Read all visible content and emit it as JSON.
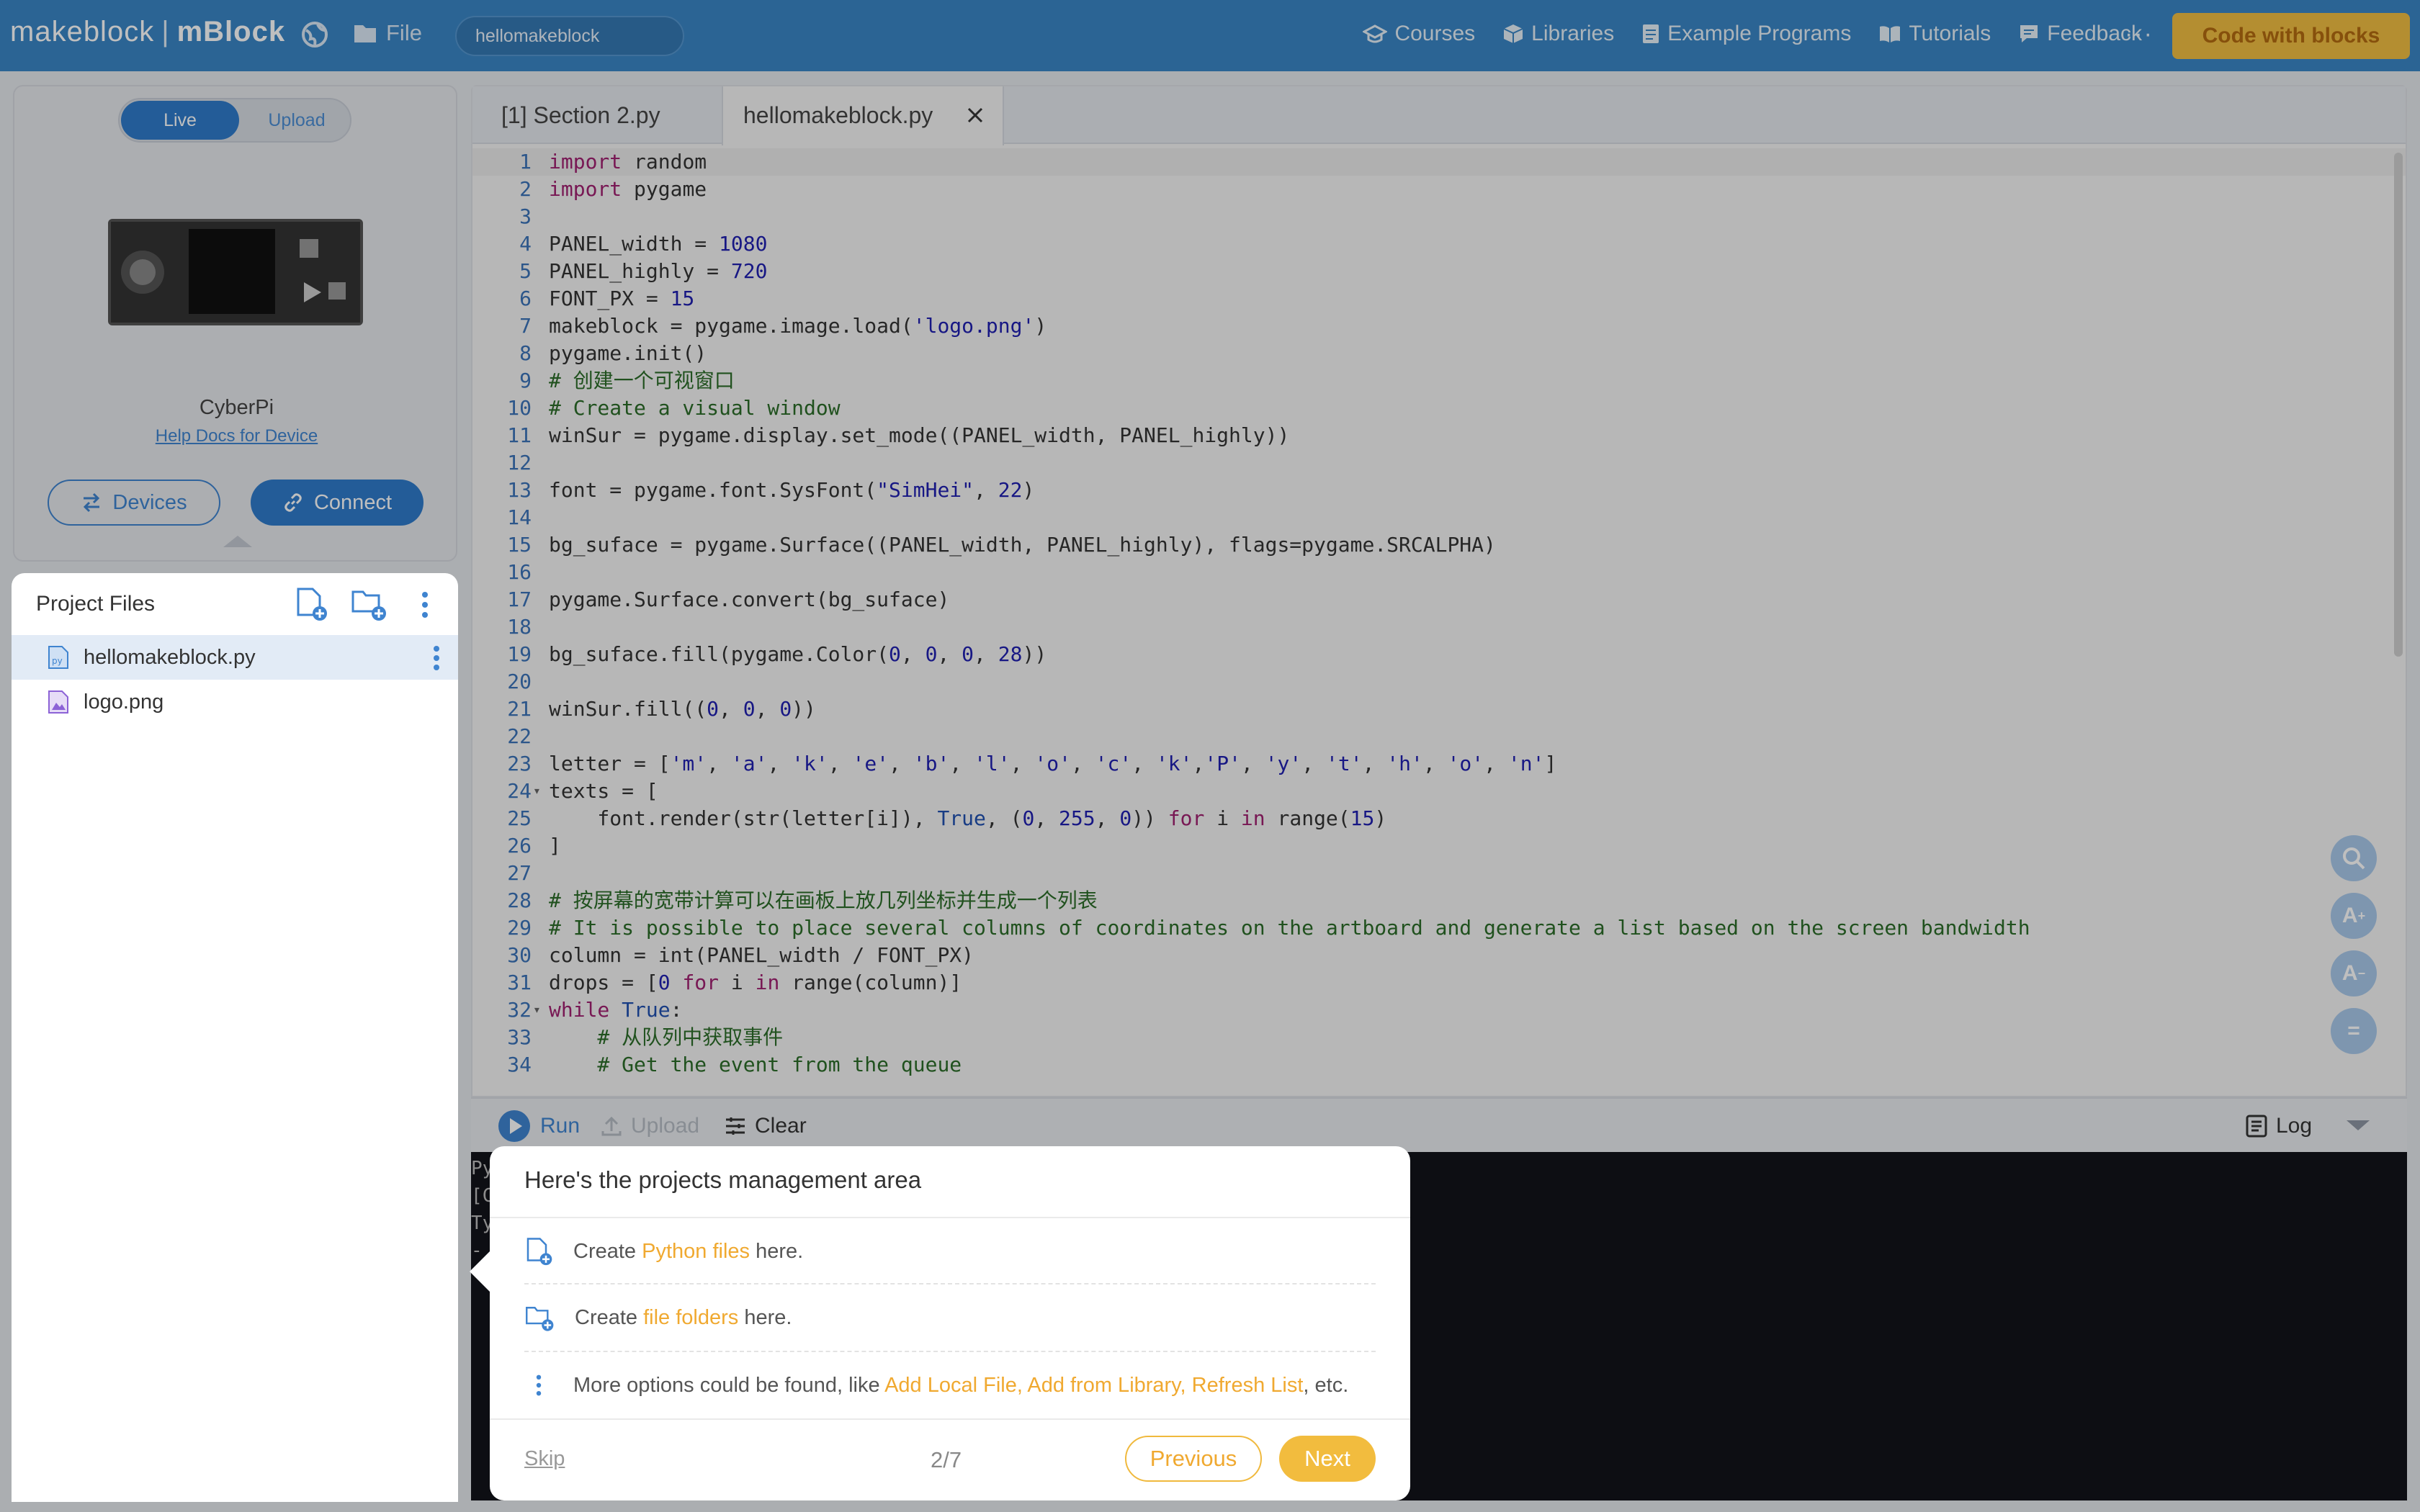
{
  "topbar": {
    "brand_left": "makeblock",
    "brand_sep": "|",
    "brand_right": "mBlock",
    "file_label": "File",
    "project_name": "hellomakeblock",
    "nav": [
      {
        "label": "Courses",
        "icon": "graduation-cap-icon"
      },
      {
        "label": "Libraries",
        "icon": "cube-icon"
      },
      {
        "label": "Example Programs",
        "icon": "document-icon"
      },
      {
        "label": "Tutorials",
        "icon": "book-icon"
      },
      {
        "label": "Feedback",
        "icon": "chat-icon"
      }
    ],
    "more": "···",
    "code_with_blocks": "Code with blocks"
  },
  "device_panel": {
    "mode_live": "Live",
    "mode_upload": "Upload",
    "device_name": "CyberPi",
    "help_docs": "Help Docs for Device",
    "devices_btn": "Devices",
    "connect_btn": "Connect"
  },
  "project_files": {
    "title": "Project Files",
    "files": [
      {
        "name": "hellomakeblock.py",
        "type": "py",
        "selected": true
      },
      {
        "name": "logo.png",
        "type": "image",
        "selected": false
      }
    ]
  },
  "editor": {
    "tabs": [
      {
        "label": "[1] Section 2.py",
        "active": false
      },
      {
        "label": "hellomakeblock.py",
        "active": true
      }
    ],
    "code_lines": [
      "import random",
      "import pygame",
      "",
      "PANEL_width = 1080",
      "PANEL_highly = 720",
      "FONT_PX = 15",
      "makeblock = pygame.image.load('logo.png')",
      "pygame.init()",
      "# 创建一个可视窗口",
      "# Create a visual window",
      "winSur = pygame.display.set_mode((PANEL_width, PANEL_highly))",
      "",
      "font = pygame.font.SysFont(\"SimHei\", 22)",
      "",
      "bg_suface = pygame.Surface((PANEL_width, PANEL_highly), flags=pygame.SRCALPHA)",
      "",
      "pygame.Surface.convert(bg_suface)",
      "",
      "bg_suface.fill(pygame.Color(0, 0, 0, 28))",
      "",
      "winSur.fill((0, 0, 0))",
      "",
      "letter = ['m', 'a', 'k', 'e', 'b', 'l', 'o', 'c', 'k','P', 'y', 't', 'h', 'o', 'n']",
      "texts = [",
      "    font.render(str(letter[i]), True, (0, 255, 0)) for i in range(15)",
      "]",
      "",
      "# 按屏幕的宽带计算可以在画板上放几列坐标并生成一个列表",
      "# It is possible to place several columns of coordinates on the artboard and generate a list based on the screen bandwidth",
      "column = int(PANEL_width / FONT_PX)",
      "drops = [0 for i in range(column)]",
      "while True:",
      "    # 从队列中获取事件",
      "    # Get the event from the queue"
    ],
    "folded_lines": [
      24,
      32
    ],
    "side_buttons": [
      "search-icon",
      "font-increase-icon",
      "font-decrease-icon",
      "format-icon"
    ]
  },
  "console": {
    "run": "Run",
    "upload": "Upload",
    "clear": "Clear",
    "log": "Log",
    "partial_text": [
      "Py",
      "[C",
      "Ty",
      "-"
    ]
  },
  "tour": {
    "title": "Here's the projects management area",
    "line1_pre": "Create ",
    "line1_hl": "Python files",
    "line1_post": " here.",
    "line2_pre": "Create ",
    "line2_hl": "file folders",
    "line2_post": " here.",
    "line3_pre": "More options could be found, like ",
    "line3_hl": "Add Local File, Add from Library, Refresh List",
    "line3_post": ", etc.",
    "skip": "Skip",
    "pager": "2/7",
    "previous": "Previous",
    "next": "Next"
  },
  "colors": {
    "topbar": "#3a86c6",
    "accent_blue": "#2f7bcb",
    "highlight_orange": "#f0a930",
    "cta_yellow": "#f1be42"
  }
}
